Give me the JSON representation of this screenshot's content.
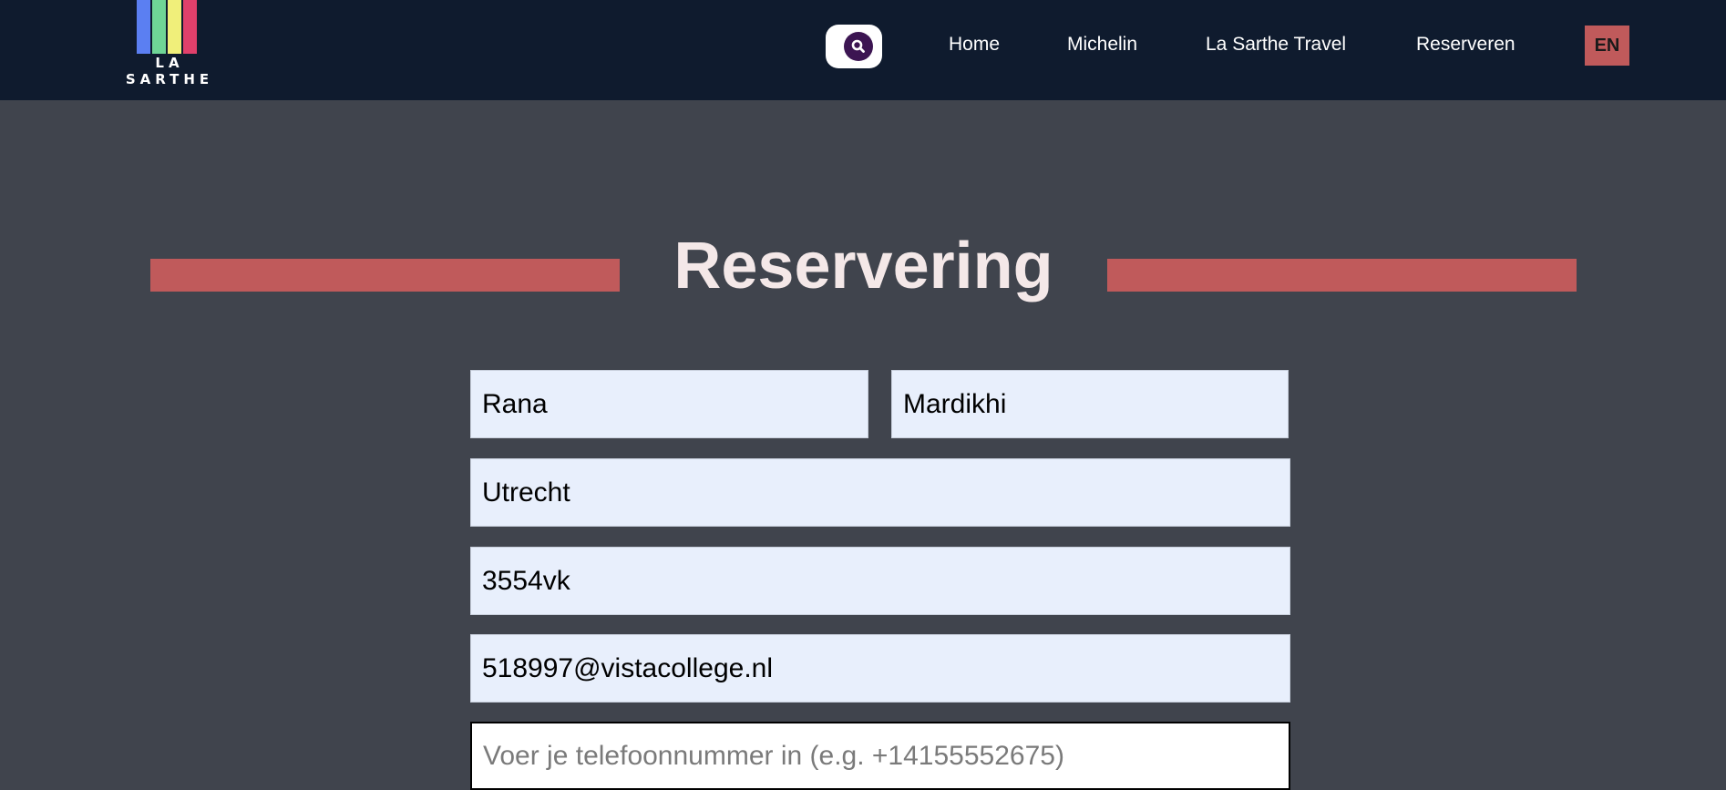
{
  "brand": {
    "logo_text": "LA SARTHE",
    "stripe_colors": [
      "#5b7ff2",
      "#6fd596",
      "#f0ef7a",
      "#e0406b"
    ]
  },
  "nav": {
    "search_icon": "search-icon",
    "links": [
      "Home",
      "Michelin",
      "La Sarthe Travel",
      "Reserveren"
    ],
    "language": "EN"
  },
  "page": {
    "title": "Reservering",
    "accent_color": "#c05a5b"
  },
  "form": {
    "first_name": "Rana",
    "last_name": "Mardikhi",
    "city": "Utrecht",
    "postal_code": "3554vk",
    "email": "518997@vistacollege.nl",
    "phone": "",
    "phone_placeholder": "Voer je telefoonnummer in (e.g. +14155552675)"
  }
}
